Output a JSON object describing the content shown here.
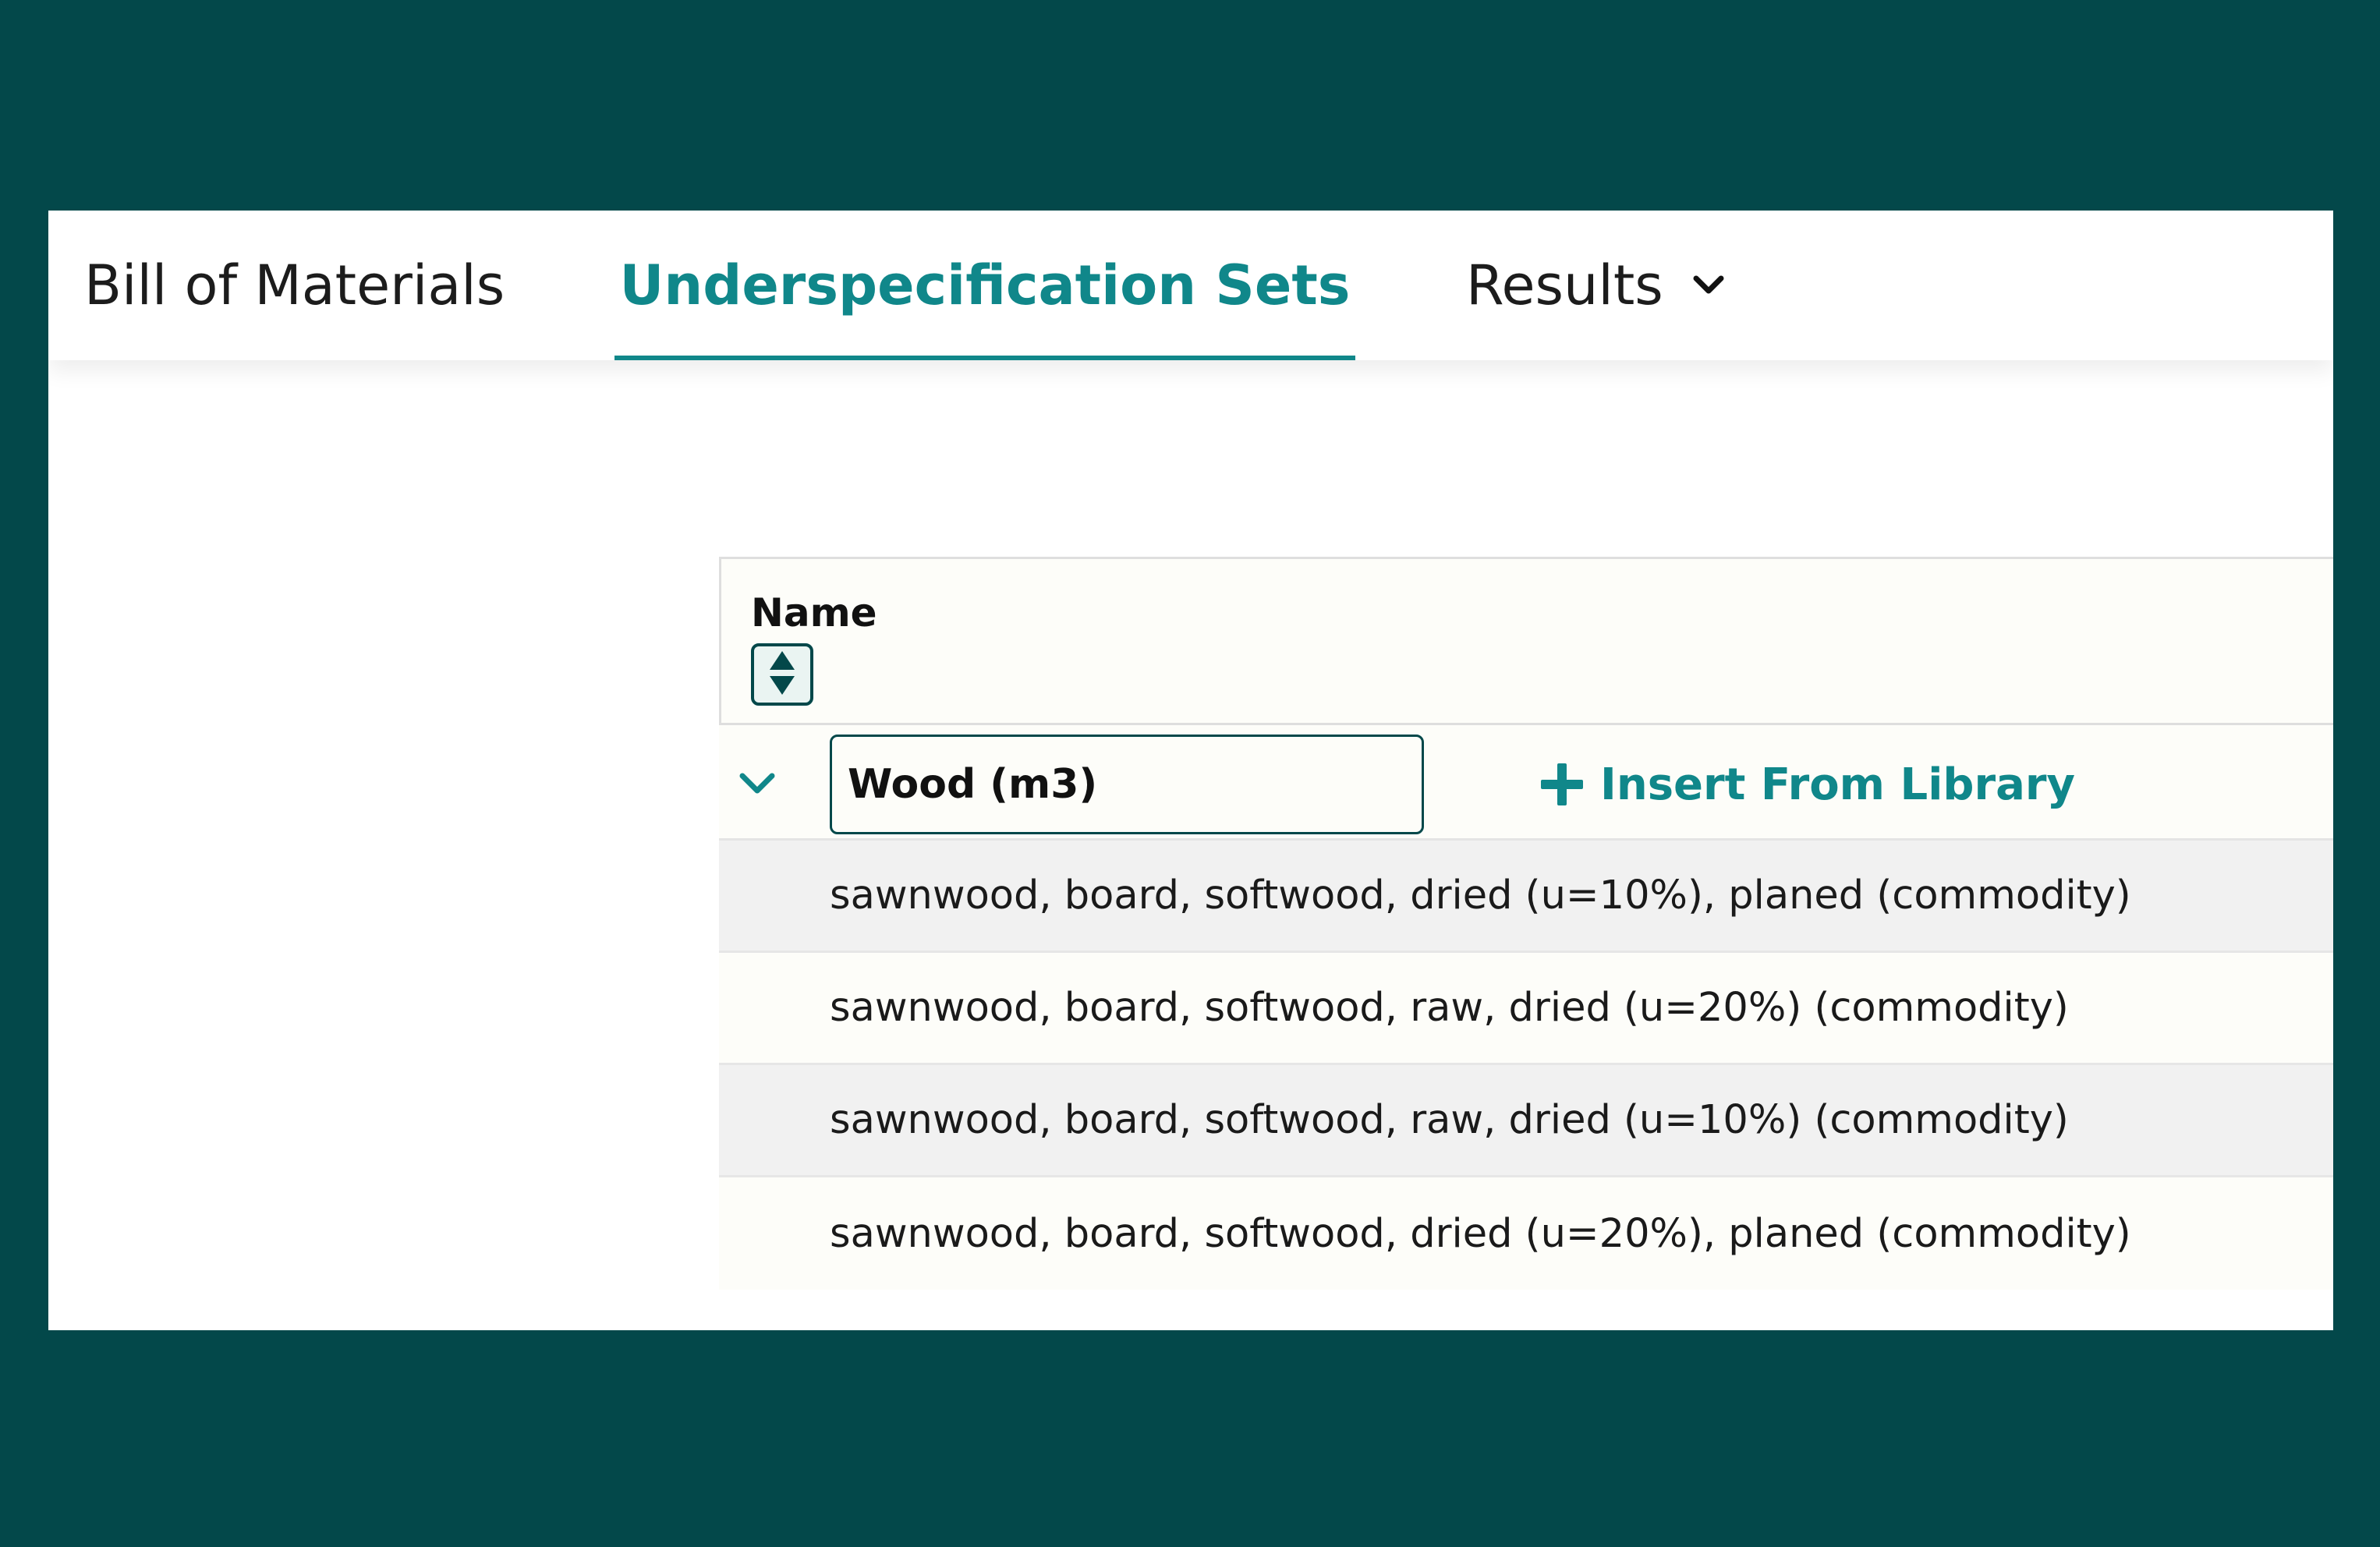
{
  "tabs": {
    "bill_of_materials": "Bill of Materials",
    "underspecification_sets": "Underspecification Sets",
    "results": "Results"
  },
  "active_tab": "Underspecification Sets",
  "table": {
    "column_name": "Name",
    "group": {
      "name_value": "Wood (m3)",
      "insert_label": "Insert From Library",
      "items": [
        "sawnwood, board, softwood, dried (u=10%), planed (commodity)",
        "sawnwood, board, softwood, raw, dried (u=20%) (commodity)",
        "sawnwood, board, softwood, raw, dried (u=10%) (commodity)",
        "sawnwood, board, softwood, dried (u=20%), planed (commodity)"
      ]
    }
  },
  "icons": {
    "sort": "sort-updown-icon",
    "expand": "chevron-down-icon",
    "results_dropdown": "chevron-down-icon",
    "insert": "plus-icon"
  },
  "colors": {
    "background": "#03484a",
    "accent": "#10878a",
    "panel": "#ffffff"
  }
}
